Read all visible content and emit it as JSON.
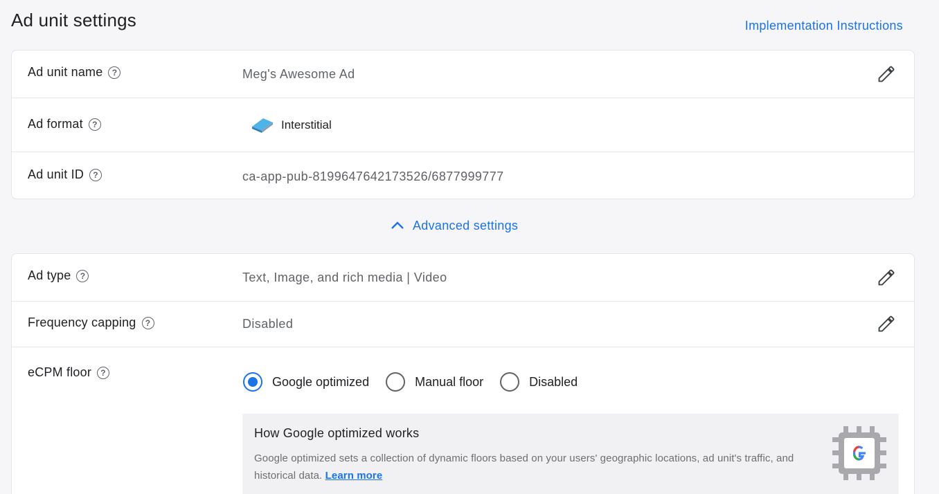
{
  "page": {
    "title": "Ad unit settings",
    "implementation_link": "Implementation Instructions"
  },
  "basic": {
    "name": {
      "label": "Ad unit name",
      "value": "Meg's Awesome Ad"
    },
    "format": {
      "label": "Ad format",
      "value": "Interstitial",
      "icon": "interstitial-icon"
    },
    "id": {
      "label": "Ad unit ID",
      "value": "ca-app-pub-8199647642173526/6877999777"
    }
  },
  "advanced_toggle": {
    "label": "Advanced settings",
    "icon": "chevron-up-icon"
  },
  "advanced": {
    "ad_type": {
      "label": "Ad type",
      "value": "Text, Image, and rich media | Video"
    },
    "frequency": {
      "label": "Frequency capping",
      "value": "Disabled"
    },
    "ecpm": {
      "label": "eCPM floor",
      "options": [
        "Google optimized",
        "Manual floor",
        "Disabled"
      ],
      "selected": "Google optimized"
    },
    "info": {
      "title": "How Google optimized works",
      "text": "Google optimized sets a collection of dynamic floors based on your users' geographic locations, ad unit's traffic, and historical data.",
      "link": "Learn more"
    }
  },
  "colors": {
    "accent": "#1a73e8",
    "muted": "#5f6368"
  }
}
